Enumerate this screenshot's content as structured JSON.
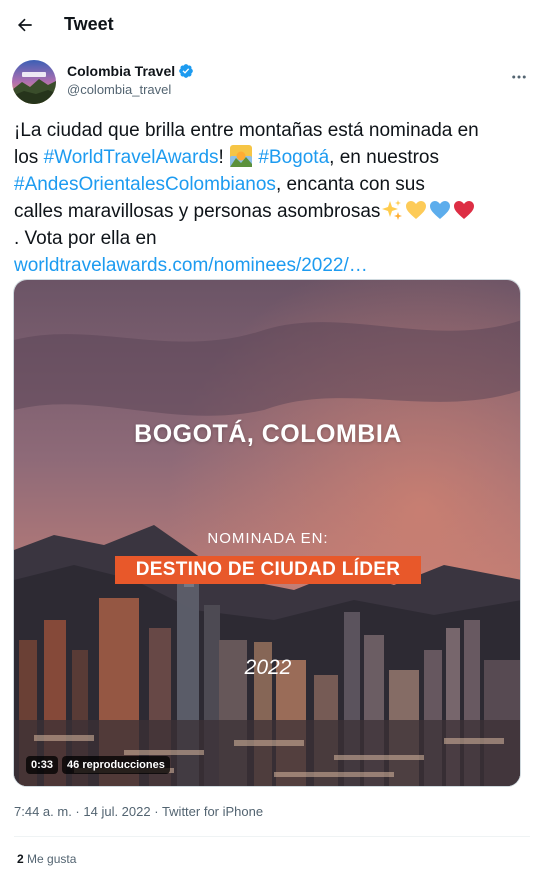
{
  "header": {
    "title": "Tweet",
    "back_icon": "arrow-left-icon"
  },
  "author": {
    "name": "Colombia Travel",
    "handle": "@colombia_travel",
    "verified_icon": "verified-badge-icon",
    "verified_color": "#1d9bf0",
    "more_icon": "more-dots-icon"
  },
  "tweet": {
    "line1": "¡La ciudad que brilla entre montañas está nominada en",
    "line2_prefix": "los ",
    "hashtag_world_travel_awards": "#WorldTravelAwards",
    "line2_mid": "! ",
    "sunrise_emoji_icon": "sunrise-mountains-emoji-icon",
    "hashtag_bogota": "#Bogotá",
    "line2_suffix": ", en nuestros",
    "hashtag_andes": "#AndesOrientalesColombianos",
    "line3_suffix": ", encanta con sus",
    "line4": "calles maravillosas y personas asombrosas",
    "emojis": [
      "sparkles-emoji-icon",
      "yellow-heart-emoji-icon",
      "blue-heart-emoji-icon",
      "red-heart-emoji-icon"
    ],
    "line5": ". Vota por ella en",
    "link_text": "worldtravelawards.com/nominees/2022/…",
    "link_color": "#1d9bf0"
  },
  "media": {
    "video_title": "BOGOTÁ, COLOMBIA",
    "video_subtitle": "NOMINADA EN:",
    "video_banner": "DESTINO DE CIUDAD LÍDER",
    "video_year": "2022",
    "duration": "0:33",
    "views": "46 reproducciones",
    "banner_color": "#e8582a"
  },
  "meta": {
    "time": "7:44 a. m.",
    "separator": " · ",
    "date": "14 jul. 2022",
    "source": "Twitter for iPhone"
  },
  "stats": {
    "likes_count": "2",
    "likes_label": "Me gusta"
  },
  "colors": {
    "text_primary": "#0f1419",
    "text_secondary": "#536471",
    "accent": "#1d9bf0"
  }
}
